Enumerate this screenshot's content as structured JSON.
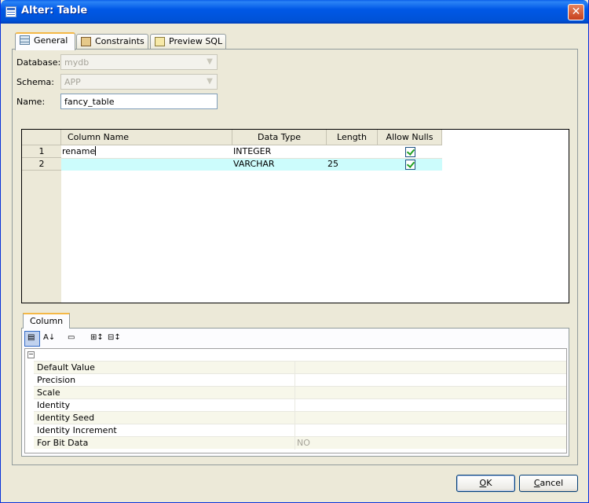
{
  "window": {
    "title": "Alter: Table",
    "close_glyph": "✕"
  },
  "tabs": [
    {
      "label": "General",
      "icon": "table-grid-icon",
      "active": true
    },
    {
      "label": "Constraints",
      "icon": "constraints-icon",
      "active": false
    },
    {
      "label": "Preview SQL",
      "icon": "sql-script-icon",
      "active": false
    }
  ],
  "form": {
    "database_label": "Database:",
    "database_value": "mydb",
    "schema_label": "Schema:",
    "schema_value": "APP",
    "name_label": "Name:",
    "name_value": "fancy_table"
  },
  "grid": {
    "headers": [
      "Column Name",
      "Data Type",
      "Length",
      "Allow Nulls"
    ],
    "rows": [
      {
        "num": "1",
        "name": "rename",
        "type": "INTEGER",
        "length": "",
        "allow_nulls": true
      },
      {
        "num": "2",
        "name": "",
        "type": "VARCHAR",
        "length": "25",
        "allow_nulls": true
      }
    ]
  },
  "properties": {
    "tab_label": "Column",
    "collapse_glyph": "−",
    "rows": [
      {
        "name": "Default Value",
        "value": ""
      },
      {
        "name": "Precision",
        "value": ""
      },
      {
        "name": "Scale",
        "value": ""
      },
      {
        "name": "Identity",
        "value": ""
      },
      {
        "name": "Identity Seed",
        "value": ""
      },
      {
        "name": "Identity Increment",
        "value": ""
      },
      {
        "name": "For Bit Data",
        "value": "NO"
      }
    ]
  },
  "buttons": {
    "ok_mnemonic": "O",
    "ok_rest": "K",
    "cancel_mnemonic": "C",
    "cancel_rest": "ancel"
  }
}
